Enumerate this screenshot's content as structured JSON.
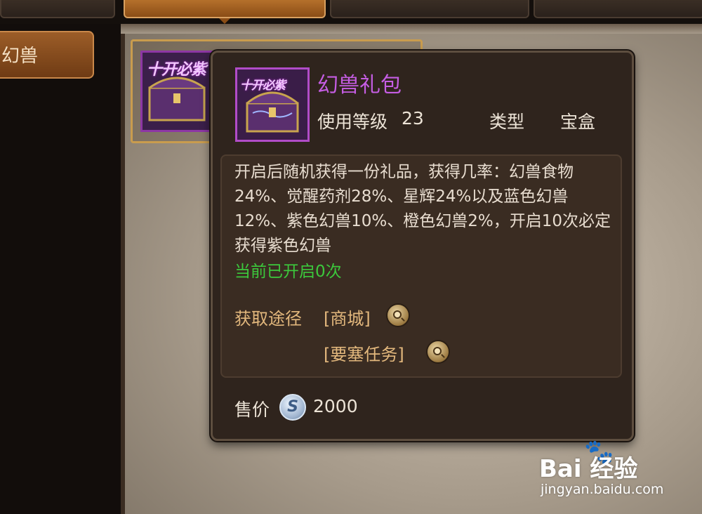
{
  "sidebar": {
    "active_tab": "幻兽"
  },
  "slot": {
    "icon_text": "十开必紫"
  },
  "tooltip": {
    "icon_text": "十开必紫",
    "item_name": "幻兽礼包",
    "level_label": "使用等级",
    "level_value": "23",
    "type_label": "类型",
    "type_value": "宝盒",
    "description": "开启后随机获得一份礼品，获得几率：幻兽食物24%、觉醒药剂28%、星辉24%以及蓝色幻兽12%、紫色幻兽10%、橙色幻兽2%，开启10次必定获得紫色幻兽",
    "opened_count": "当前已开启0次",
    "source_label": "获取途径",
    "sources": [
      "[商城]",
      "[要塞任务]"
    ],
    "price_label": "售价",
    "price_coin": "S",
    "price_value": "2000"
  },
  "colors": {
    "item_name": "#c55de3",
    "opened_text": "#3cc83c",
    "source_text": "#e3b87d"
  },
  "watermark": {
    "logo": "Bai 经验",
    "paw": "🐾",
    "url": "jingyan.baidu.com"
  }
}
